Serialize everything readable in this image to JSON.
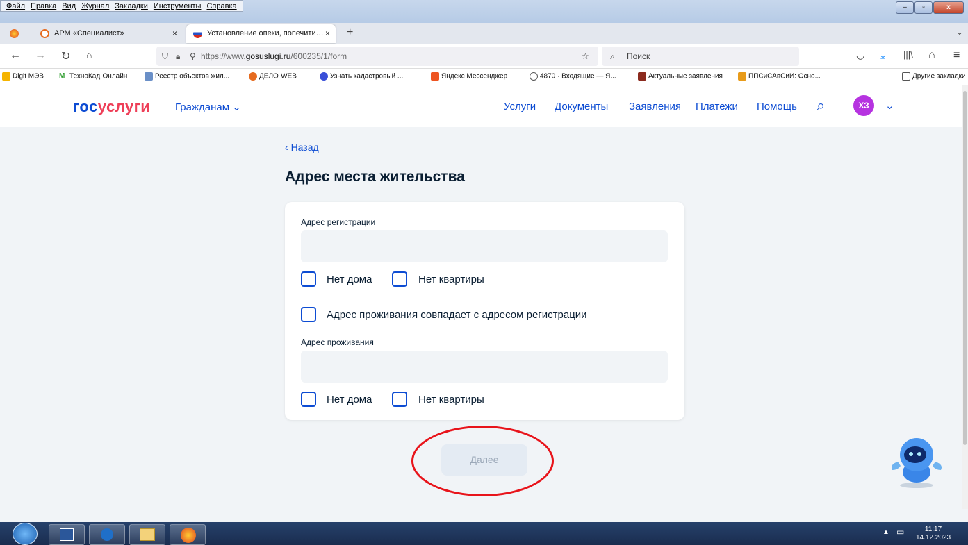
{
  "menu": [
    "Файл",
    "Правка",
    "Вид",
    "Журнал",
    "Закладки",
    "Инструменты",
    "Справка"
  ],
  "tabs": [
    {
      "label": "АРМ «Специалист»",
      "close": "×"
    },
    {
      "label": "Установление опеки, попечити…",
      "close": "×"
    }
  ],
  "tab_new": "+",
  "url": {
    "prefix": "https://www.",
    "host": "gosuslugi.ru",
    "path": "/600235/1/form"
  },
  "search_placeholder": "Поиск",
  "bookmarks": [
    "Digit МЭВ",
    "ТехноКад-Онлайн",
    "Реестр объектов жил...",
    "ДЕЛО-WEB",
    "Узнать кадастровый ...",
    "Яндекс Мессенджер",
    "4870 · Входящие — Я...",
    "Актуальные заявления",
    "ППСиСАвСиИ: Осно..."
  ],
  "bookmarks_other": "Другие закладки",
  "site": {
    "logo_a": "гос",
    "logo_b": "услуги",
    "citizens": "Гражданам",
    "nav": [
      "Услуги",
      "Документы",
      "Заявления",
      "Платежи",
      "Помощь"
    ],
    "avatar": "ХЗ"
  },
  "form": {
    "back": "Назад",
    "title": "Адрес места жительства",
    "reg_label": "Адрес регистрации",
    "no_house": "Нет дома",
    "no_flat": "Нет квартиры",
    "same_address": "Адрес проживания совпадает с адресом регистрации",
    "live_label": "Адрес проживания",
    "no_house2": "Нет дома",
    "no_flat2": "Нет квартиры",
    "next": "Далее"
  },
  "clock": {
    "time": "11:17",
    "date": "14.12.2023"
  },
  "colors": {
    "brand_blue": "#0d4cd3",
    "brand_red": "#ee3f58",
    "annotation_red": "#e8141b"
  }
}
